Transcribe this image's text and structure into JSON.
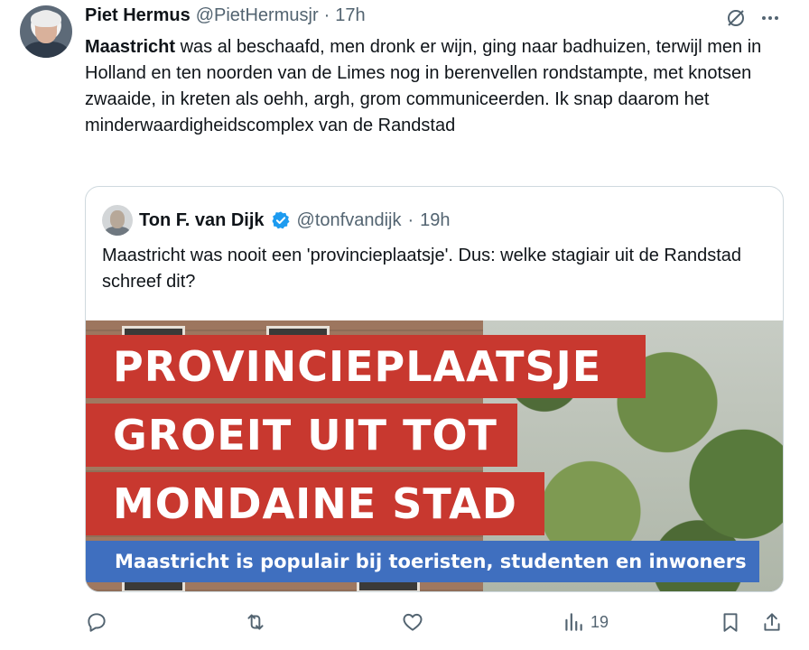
{
  "author": {
    "name": "Piet Hermus",
    "handle": "@PietHermusjr",
    "separator": "·",
    "time": "17h"
  },
  "tweet": {
    "bold_lead": "Maastricht",
    "text": " was al beschaafd, men dronk er wijn, ging naar badhuizen, terwijl men in Holland en ten noorden van de Limes nog in berenvellen rondstampte, met knotsen zwaaide, in kreten als oehh, argh, grom communiceerden. Ik snap daarom het minderwaardigheidscomplex van de Randstad"
  },
  "quoted": {
    "name": "Ton F. van Dijk",
    "handle": "@tonfvandijk",
    "separator": "·",
    "time": "19h",
    "text": "Maastricht was nooit een 'provincieplaatsje'. Dus: welke stagiair uit de Randstad schreef dit?",
    "media": {
      "line1": "PROVINCIEPLAATSJE",
      "line2": "GROEIT UIT TOT",
      "line3": "MONDAINE STAD",
      "subtitle": "Maastricht is populair bij toeristen, studenten en inwoners",
      "banner_color": "#c8382f",
      "subtitle_color": "#3f6fbf"
    }
  },
  "actions": {
    "reply_icon": "reply-icon",
    "retweet_icon": "retweet-icon",
    "like_icon": "heart-icon",
    "views_icon": "views-icon",
    "views_count": "19",
    "bookmark_icon": "bookmark-icon",
    "share_icon": "share-icon"
  },
  "colors": {
    "text": "#0f1419",
    "muted": "#536471",
    "verified": "#1d9bf0",
    "border": "#cfd9de"
  }
}
